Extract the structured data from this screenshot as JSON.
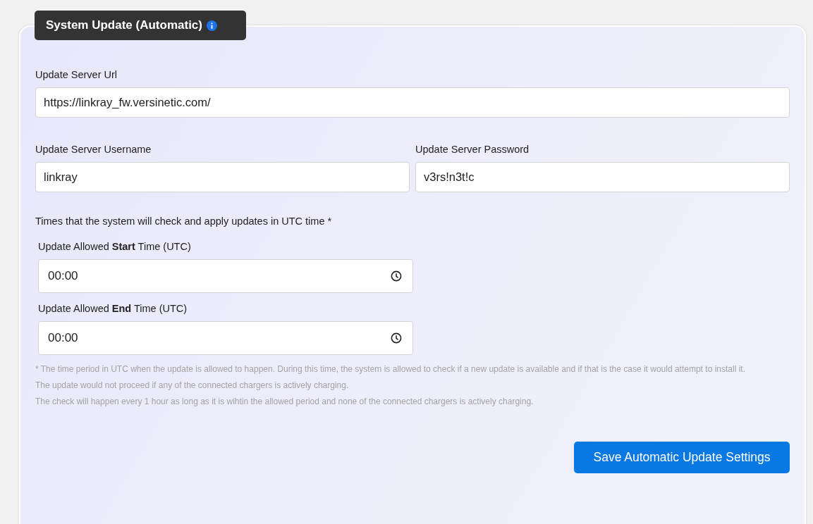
{
  "panel": {
    "title": "System Update (Automatic)"
  },
  "url_field": {
    "label": "Update Server Url",
    "value": "https://linkray_fw.versinetic.com/"
  },
  "username_field": {
    "label": "Update Server Username",
    "value": "linkray"
  },
  "password_field": {
    "label": "Update Server Password",
    "value": "v3rs!n3t!c"
  },
  "times_intro": "Times that the system will check and apply updates in UTC time *",
  "time_fields": [
    {
      "label": "Update Allowed **Start** Time (UTC)",
      "value": "00:00"
    },
    {
      "label": "Update Allowed **End** Time (UTC)",
      "value": "00:00"
    }
  ],
  "notes": [
    "* The time period in UTC when the update is allowed to happen. During this time, the system is allowed to check if a new update is available and if that is the case it would attempt to install it.",
    "The update would not proceed if any of the connected chargers is actively charging.",
    "The check will happen every 1 hour as long as it is wihtin the allowed period and none of the connected chargers is actively charging."
  ],
  "save_button": "Save Automatic Update Settings"
}
